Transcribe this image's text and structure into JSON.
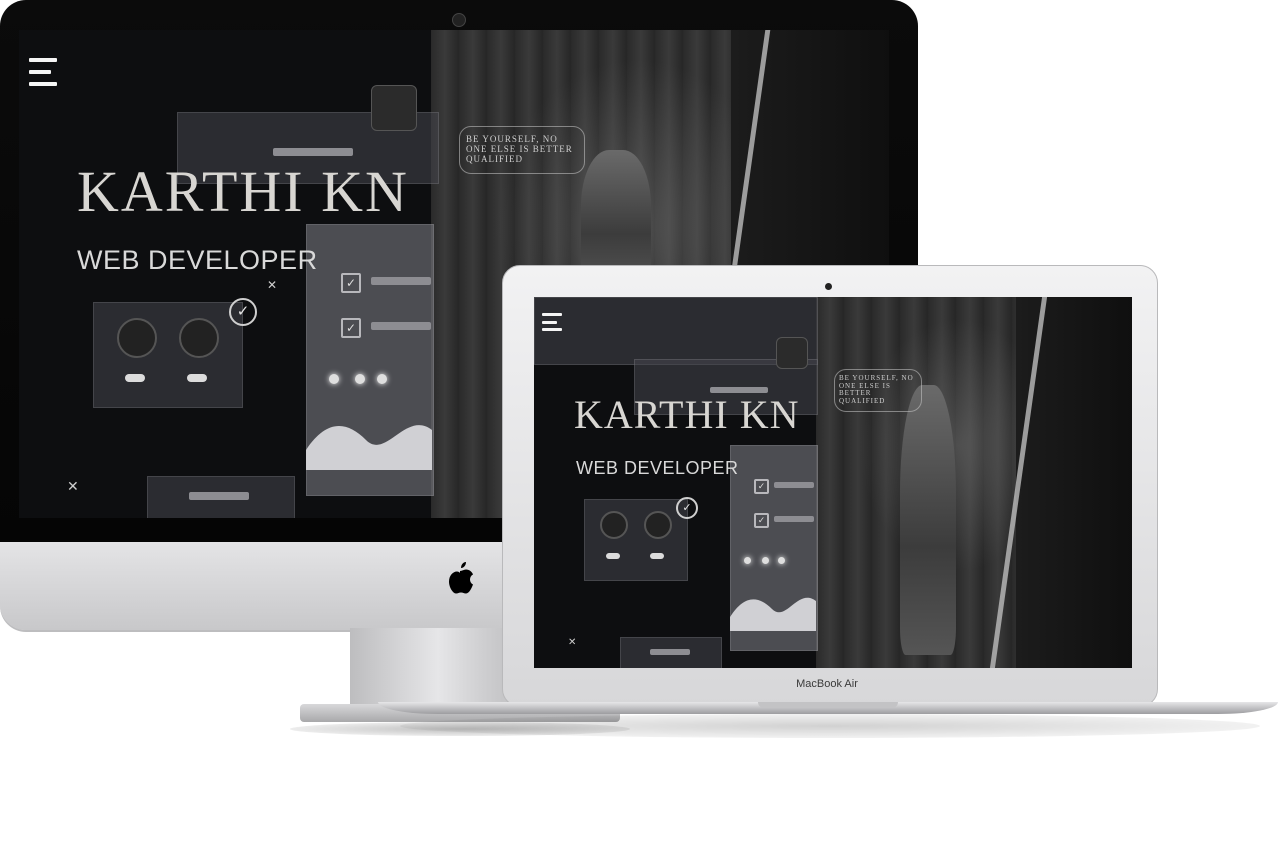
{
  "portfolio": {
    "brand_name": "KARTHI KN",
    "role": "WEB DEVELOPER",
    "quote": "BE YOURSELF, NO ONE ELSE IS BETTER QUALIFIED"
  },
  "devices": {
    "laptop_label": "MacBook Air"
  },
  "icons": {
    "menu": "hamburger-menu-icon",
    "apple": "apple-logo-icon",
    "checkbox": "checkbox-checked-icon",
    "check": "check-circle-icon",
    "close": "close-x-icon",
    "bag": "money-bag-icon"
  },
  "colors": {
    "screen_bg": "#0d0e10",
    "brand_text": "#d8d6d2",
    "device_silver": "#d7d7d9"
  }
}
